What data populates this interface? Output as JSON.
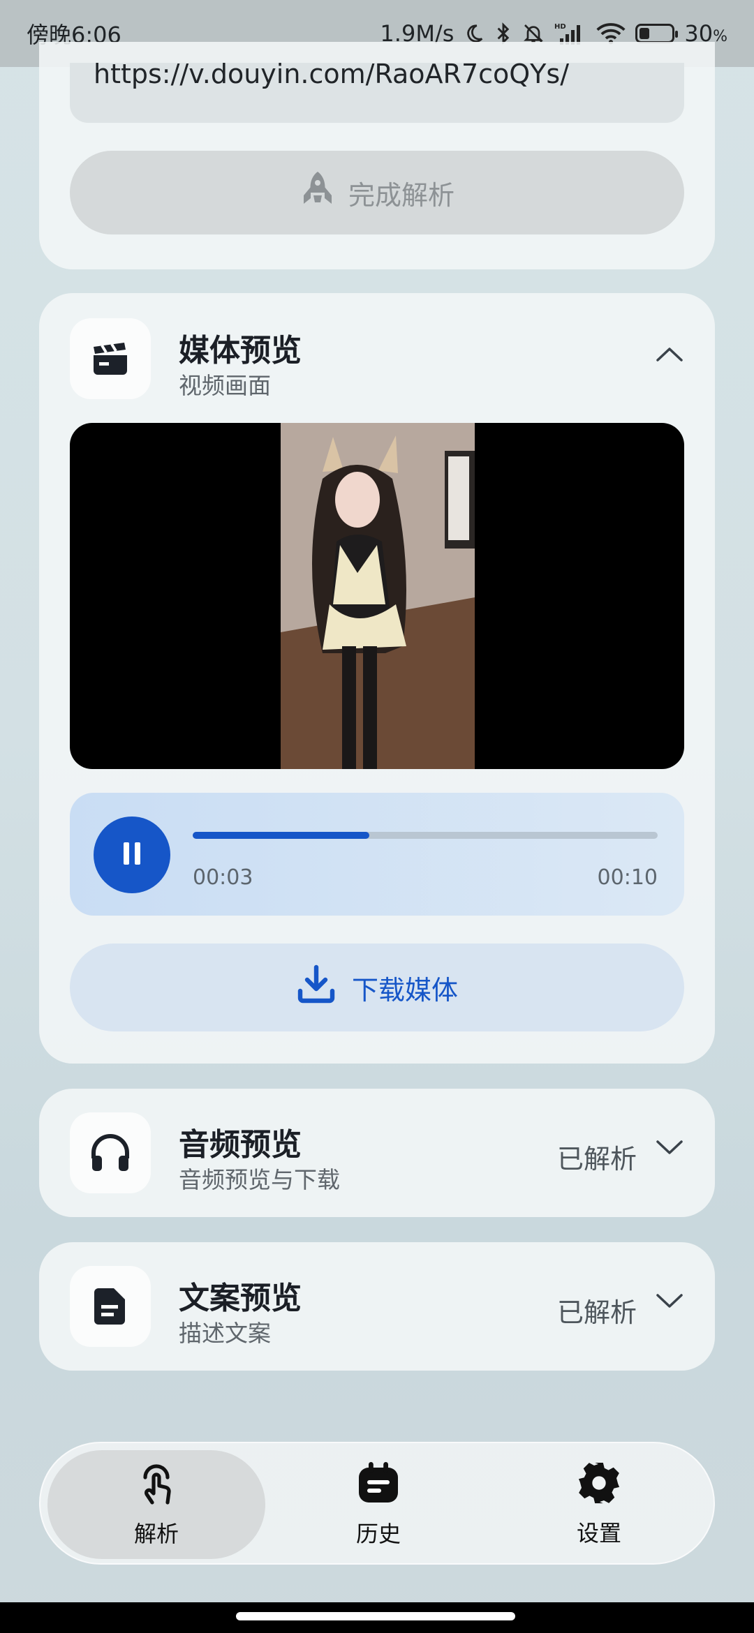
{
  "status_bar": {
    "time": "傍晚6:06",
    "network_speed": "1.9M/s",
    "battery": "30",
    "battery_unit": "%",
    "battery_level": 0.3,
    "hd_label": "HD"
  },
  "parse_card": {
    "url": "https://v.douyin.com/RaoAR7coQYs/",
    "button_label": "完成解析"
  },
  "media_preview": {
    "title": "媒体预览",
    "subtitle": "视频画面",
    "player": {
      "current_time": "00:03",
      "duration": "00:10",
      "progress": 0.38
    },
    "download_label": "下载媒体"
  },
  "audio_preview": {
    "title": "音频预览",
    "subtitle": "音频预览与下载",
    "status": "已解析"
  },
  "text_preview": {
    "title": "文案预览",
    "subtitle": "描述文案",
    "status": "已解析"
  },
  "nav": {
    "items": [
      {
        "label": "解析",
        "icon": "touch-icon",
        "active": true
      },
      {
        "label": "历史",
        "icon": "calendar-icon",
        "active": false
      },
      {
        "label": "设置",
        "icon": "gear-icon",
        "active": false
      }
    ]
  },
  "colors": {
    "accent": "#1656c8",
    "background": "#d6e3e6"
  }
}
